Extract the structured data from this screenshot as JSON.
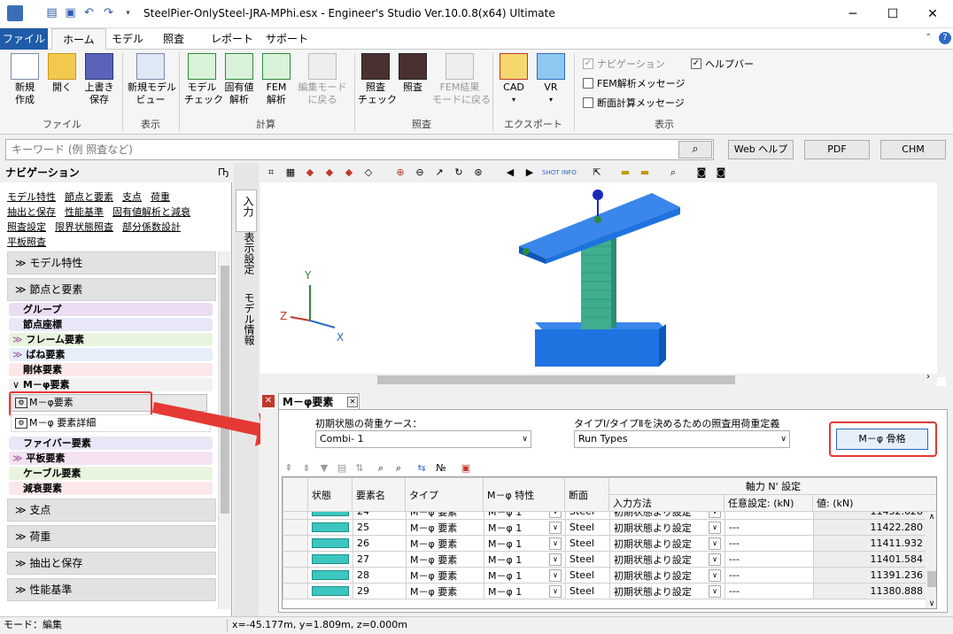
{
  "window": {
    "title": "SteelPier-OnlySteel-JRA-MPhi.esx - Engineer's Studio Ver.10.0.8(x64) Ultimate",
    "minimize": "─",
    "maximize": "☐",
    "close": "✕"
  },
  "menu_tabs": [
    "ファイル",
    "ホーム",
    "モデル",
    "照査",
    "レポート",
    "サポート"
  ],
  "ribbon": {
    "file_group": {
      "label": "ファイル",
      "buttons": [
        "新規\n作成",
        "開く",
        "上書き\n保存"
      ]
    },
    "view_group": {
      "label": "表示",
      "buttons": [
        "新規モデル\nビュー"
      ]
    },
    "calc_group": {
      "label": "計算",
      "buttons": [
        "モデル\nチェック",
        "固有値\n解析",
        "FEM\n解析",
        "編集モード\nに戻る"
      ]
    },
    "check_group": {
      "label": "照査",
      "buttons": [
        "照査\nチェック",
        "照査",
        "FEM結果\nモードに戻る"
      ]
    },
    "export_group": {
      "label": "エクスポート",
      "buttons": [
        "CAD",
        "VR"
      ]
    },
    "display_group": {
      "label": "表示",
      "checks": [
        {
          "label": "ナビゲーション",
          "checked": true,
          "disabled": true
        },
        {
          "label": "ヘルプバー",
          "checked": true,
          "disabled": false
        },
        {
          "label": "FEM解析メッセージ",
          "checked": false,
          "disabled": false
        },
        {
          "label": "断面計算メッセージ",
          "checked": false,
          "disabled": false
        }
      ]
    }
  },
  "search": {
    "placeholder": "キーワード (例 照査など)",
    "web_help": "Web ヘルプ",
    "pdf": "PDF",
    "chm": "CHM"
  },
  "nav": {
    "title": "ナビゲーション",
    "pin": "Ҧ",
    "links": [
      "モデル特性",
      "節点と要素",
      "支点",
      "荷重",
      "抽出と保存",
      "性能基準",
      "固有値解析と減衰",
      "照査設定",
      "限界状態照査",
      "部分係数設計",
      "平板照査"
    ],
    "sections_top": [
      "≫ モデル特性",
      "≫ 節点と要素"
    ],
    "items": [
      {
        "label": "グループ",
        "bg": "#ecdcf2",
        "prefix": ""
      },
      {
        "label": "節点座標",
        "bg": "#e7e7f7",
        "prefix": ""
      },
      {
        "label": "フレーム要素",
        "bg": "#e9f4df",
        "prefix": "≫"
      },
      {
        "label": "ばね要素",
        "bg": "#e6eef9",
        "prefix": "≫"
      },
      {
        "label": "剛体要素",
        "bg": "#fbe7e7",
        "prefix": ""
      },
      {
        "label": "M－φ要素",
        "bg": "#f1f1f1",
        "prefix": "∨"
      }
    ],
    "sub_items": [
      "M－φ要素",
      "M－φ 要素詳細"
    ],
    "items_after": [
      {
        "label": "ファイバー要素",
        "bg": "#e7e7f7",
        "prefix": ""
      },
      {
        "label": "平板要素",
        "bg": "#f4e3f2",
        "prefix": "≫"
      },
      {
        "label": "ケーブル要素",
        "bg": "#e9f4df",
        "prefix": ""
      },
      {
        "label": "減衰要素",
        "bg": "#fbe7e7",
        "prefix": ""
      }
    ],
    "sections_bottom": [
      "≫ 支点",
      "≫ 荷重",
      "≫ 抽出と保存",
      "≫ 性能基準"
    ]
  },
  "vtabs": [
    "入力",
    "表示設定",
    "モデル情報"
  ],
  "axes": {
    "x": "X",
    "y": "Y",
    "z": "Z"
  },
  "panel": {
    "tab": "M－φ要素",
    "load_case_label": "初期状態の荷重ケース：",
    "load_case_value": "Combi- 1",
    "type_label": "タイプⅠ/タイプⅡを決めるための照査用荷重定義",
    "type_value": "Run Types",
    "skeleton_button": "M－φ 骨格",
    "columns": {
      "status": "状態",
      "name": "要素名",
      "type": "タイプ",
      "mphi": "M－φ 特性",
      "section": "断面",
      "axial": "軸力 N' 設定",
      "input_method": "入力方法",
      "optional": "任意設定: (kN)",
      "value": "値: (kN)"
    },
    "rows": [
      {
        "name": "24",
        "type": "M－φ 要素",
        "mphi": "M－φ 1",
        "section": "Steel",
        "method": "初期状態より設定",
        "opt": "",
        "val": "11432.628"
      },
      {
        "name": "25",
        "type": "M－φ 要素",
        "mphi": "M－φ 1",
        "section": "Steel",
        "method": "初期状態より設定",
        "opt": "---",
        "val": "11422.280"
      },
      {
        "name": "26",
        "type": "M－φ 要素",
        "mphi": "M－φ 1",
        "section": "Steel",
        "method": "初期状態より設定",
        "opt": "---",
        "val": "11411.932"
      },
      {
        "name": "27",
        "type": "M－φ 要素",
        "mphi": "M－φ 1",
        "section": "Steel",
        "method": "初期状態より設定",
        "opt": "---",
        "val": "11401.584"
      },
      {
        "name": "28",
        "type": "M－φ 要素",
        "mphi": "M－φ 1",
        "section": "Steel",
        "method": "初期状態より設定",
        "opt": "---",
        "val": "11391.236"
      },
      {
        "name": "29",
        "type": "M－φ 要素",
        "mphi": "M－φ 1",
        "section": "Steel",
        "method": "初期状態より設定",
        "opt": "---",
        "val": "11380.888"
      }
    ]
  },
  "status": {
    "mode": "モード：編集",
    "coords": "x=-45.177m, y=1.809m, z=0.000m"
  },
  "colors": {
    "accent": "#1e5ba8",
    "highlight": "#e53935",
    "status_cell": "#3cc6c0",
    "pier": "#1f73e0"
  }
}
